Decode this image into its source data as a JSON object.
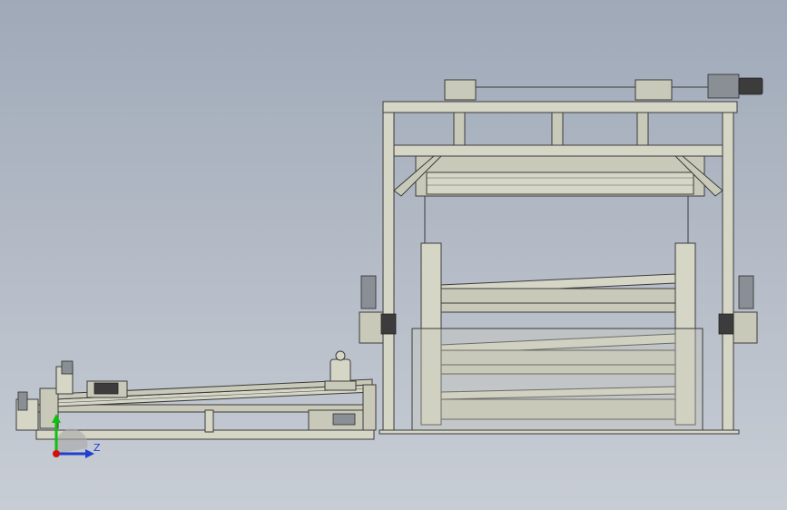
{
  "viewport": {
    "background_top": "#9fa9b8",
    "background_bottom": "#c8cdd5",
    "model_color": "#d6d6c7",
    "outline_color": "#3b3b3b"
  },
  "triad": {
    "z_label": "Z",
    "y_color": "#10c010",
    "z_color": "#1f3fd0",
    "origin_color": "#d01010"
  }
}
